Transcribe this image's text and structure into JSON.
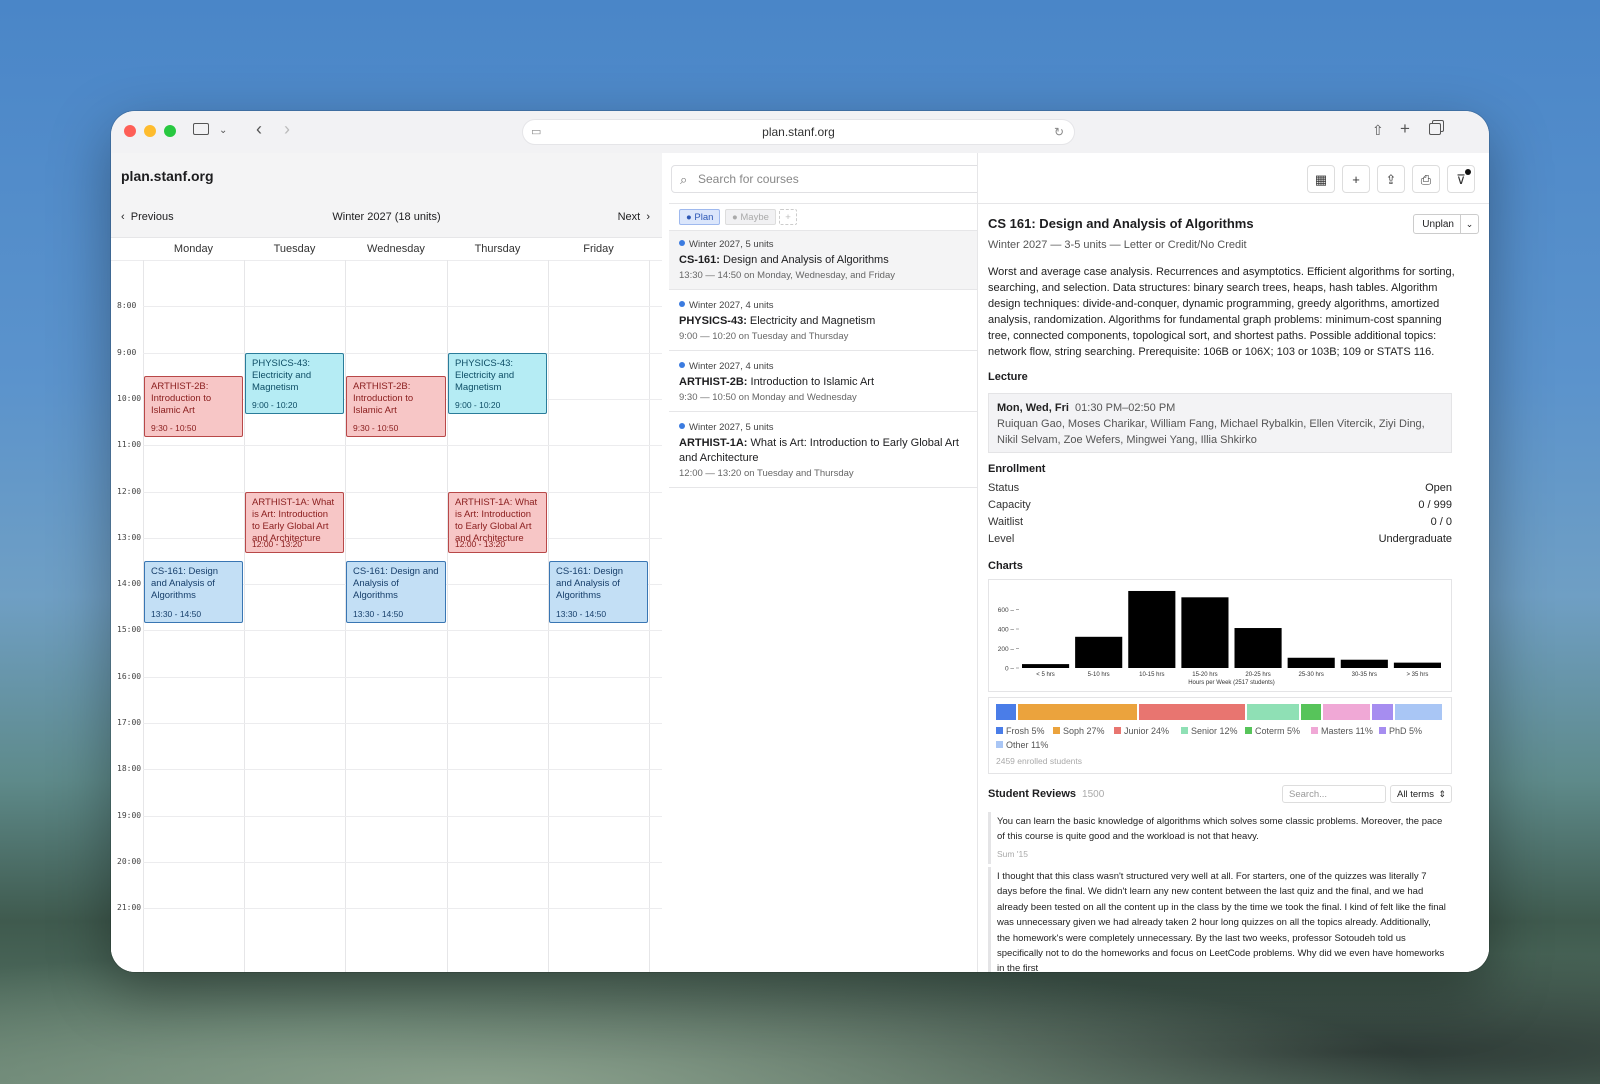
{
  "browser": {
    "url": "plan.stanf.org"
  },
  "app": {
    "brand": "plan.stanf.org"
  },
  "nav": {
    "prev": "Previous",
    "term": "Winter 2027 (18 units)",
    "next": "Next"
  },
  "days": [
    "Monday",
    "Tuesday",
    "Wednesday",
    "Thursday",
    "Friday"
  ],
  "times": [
    "8:00",
    "9:00",
    "10:00",
    "11:00",
    "12:00",
    "13:00",
    "14:00",
    "15:00",
    "16:00",
    "17:00",
    "18:00",
    "19:00",
    "20:00",
    "21:00"
  ],
  "events": [
    {
      "title": "ARTHIST-2B: Introduction to Islamic Art",
      "time": "9:30 - 10:50",
      "day": 0,
      "start": 9.5,
      "end": 10.8333,
      "color": "red"
    },
    {
      "title": "PHYSICS-43: Electricity and Magnetism",
      "time": "9:00 - 10:20",
      "day": 1,
      "start": 9.0,
      "end": 10.3333,
      "color": "cyan"
    },
    {
      "title": "ARTHIST-2B: Introduction to Islamic Art",
      "time": "9:30 - 10:50",
      "day": 2,
      "start": 9.5,
      "end": 10.8333,
      "color": "red"
    },
    {
      "title": "PHYSICS-43: Electricity and Magnetism",
      "time": "9:00 - 10:20",
      "day": 3,
      "start": 9.0,
      "end": 10.3333,
      "color": "cyan"
    },
    {
      "title": "ARTHIST-1A: What is Art: Introduction to Early Global Art and Architecture",
      "time": "12:00 - 13:20",
      "day": 1,
      "start": 12.0,
      "end": 13.3333,
      "color": "red"
    },
    {
      "title": "ARTHIST-1A: What is Art: Introduction to Early Global Art and Architecture",
      "time": "12:00 - 13:20",
      "day": 3,
      "start": 12.0,
      "end": 13.3333,
      "color": "red"
    },
    {
      "title": "CS-161: Design and Analysis of Algorithms",
      "time": "13:30 - 14:50",
      "day": 0,
      "start": 13.5,
      "end": 14.8333,
      "color": "blue"
    },
    {
      "title": "CS-161: Design and Analysis of Algorithms",
      "time": "13:30 - 14:50",
      "day": 2,
      "start": 13.5,
      "end": 14.8333,
      "color": "blue"
    },
    {
      "title": "CS-161: Design and Analysis of Algorithms",
      "time": "13:30 - 14:50",
      "day": 4,
      "start": 13.5,
      "end": 14.8333,
      "color": "blue"
    }
  ],
  "search": {
    "placeholder": "Search for courses"
  },
  "filters": {
    "plan": "Plan",
    "maybe": "Maybe",
    "add": "+"
  },
  "courses": [
    {
      "term": "Winter 2027, 5 units",
      "code": "CS-161:",
      "name": " Design and Analysis of Algorithms",
      "when": "13:30 — 14:50 on Monday, Wednesday, and Friday"
    },
    {
      "term": "Winter 2027, 4 units",
      "code": "PHYSICS-43:",
      "name": " Electricity and Magnetism",
      "when": "9:00 — 10:20 on Tuesday and Thursday"
    },
    {
      "term": "Winter 2027, 4 units",
      "code": "ARTHIST-2B:",
      "name": " Introduction to Islamic Art",
      "when": "9:30 — 10:50 on Monday and Wednesday"
    },
    {
      "term": "Winter 2027, 5 units",
      "code": "ARTHIST-1A:",
      "name": " What is Art: Introduction to Early Global Art and Architecture",
      "when": "12:00 — 13:20 on Tuesday and Thursday"
    }
  ],
  "detail": {
    "title": "CS 161: Design and Analysis of Algorithms",
    "subtitle": "Winter 2027 — 3-5 units — Letter or Credit/No Credit",
    "unplan": "Unplan",
    "description": "Worst and average case analysis. Recurrences and asymptotics. Efficient algorithms for sorting, searching, and selection. Data structures: binary search trees, heaps, hash tables. Algorithm design techniques: divide-and-conquer, dynamic programming, greedy algorithms, amortized analysis, randomization. Algorithms for fundamental graph problems: minimum-cost spanning tree, connected components, topological sort, and shortest paths. Possible additional topics: network flow, string searching. Prerequisite: 106B or 106X; 103 or 103B; 109 or STATS 116.",
    "lecture_h": "Lecture",
    "lecture_days": "Mon, Wed, Fri",
    "lecture_time": "01:30 PM–02:50 PM",
    "instructors": "Ruiquan Gao, Moses Charikar, William Fang, Michael Rybalkin, Ellen Vitercik, Ziyi Ding, Nikil Selvam, Zoe Wefers, Mingwei Yang, Illia Shkirko",
    "enroll_h": "Enrollment",
    "enrollment": [
      {
        "k": "Status",
        "v": "Open"
      },
      {
        "k": "Capacity",
        "v": "0 / 999"
      },
      {
        "k": "Waitlist",
        "v": "0 / 0"
      },
      {
        "k": "Level",
        "v": "Undergraduate"
      }
    ],
    "charts_h": "Charts",
    "reviews_h": "Student Reviews",
    "reviews_count": "1500",
    "reviews_search": "Search...",
    "reviews_term": "All terms",
    "reviews": [
      {
        "text": "You can learn the basic knowledge of algorithms which solves some classic problems. Moreover, the pace of this course is quite good and the workload is not that heavy.",
        "sig": "Sum '15"
      },
      {
        "text": "I thought that this class wasn't structured very well at all. For starters, one of the quizzes was literally 7 days before the final. We didn't learn any new content between the last quiz and the final, and we had already been tested on all the content up in the class by the time we took the final. I kind of felt like the final was unnecessary given we had already taken 2 hour long quizzes on all the topics already. Additionally, the homework's were completely unnecessary. By the last two weeks, professor Sotoudeh told us specifically not to do the homeworks and focus on LeetCode problems. Why did we even have homeworks in the first",
        "sig": ""
      }
    ]
  },
  "chart_data": [
    {
      "type": "bar",
      "categories": [
        "< 5 hrs",
        "5-10 hrs",
        "10-15 hrs",
        "15-20 hrs",
        "20-25 hrs",
        "25-30 hrs",
        "30-35 hrs",
        "> 35 hrs"
      ],
      "values": [
        40,
        320,
        790,
        725,
        410,
        105,
        85,
        55
      ],
      "xlabel": "Hours per Week (2517 students)",
      "ylabel": "",
      "yticks": [
        0,
        200,
        400,
        600
      ],
      "ylim": [
        0,
        800
      ],
      "color": "#000000"
    },
    {
      "type": "bar",
      "orientation": "stacked-horizontal",
      "series": [
        {
          "name": "Frosh 5%",
          "value": 5,
          "color": "#4a7de8"
        },
        {
          "name": "Soph 27%",
          "value": 27,
          "color": "#eba33d"
        },
        {
          "name": "Junior 24%",
          "value": 24,
          "color": "#e87570"
        },
        {
          "name": "Senior 12%",
          "value": 12,
          "color": "#8fe0b5"
        },
        {
          "name": "Coterm 5%",
          "value": 5,
          "color": "#57c45a"
        },
        {
          "name": "Masters 11%",
          "value": 11,
          "color": "#f0a8d6"
        },
        {
          "name": "PhD 5%",
          "value": 5,
          "color": "#a68df0"
        },
        {
          "name": "Other 11%",
          "value": 11,
          "color": "#a9c6f5"
        }
      ],
      "caption": "2459 enrolled students"
    }
  ]
}
